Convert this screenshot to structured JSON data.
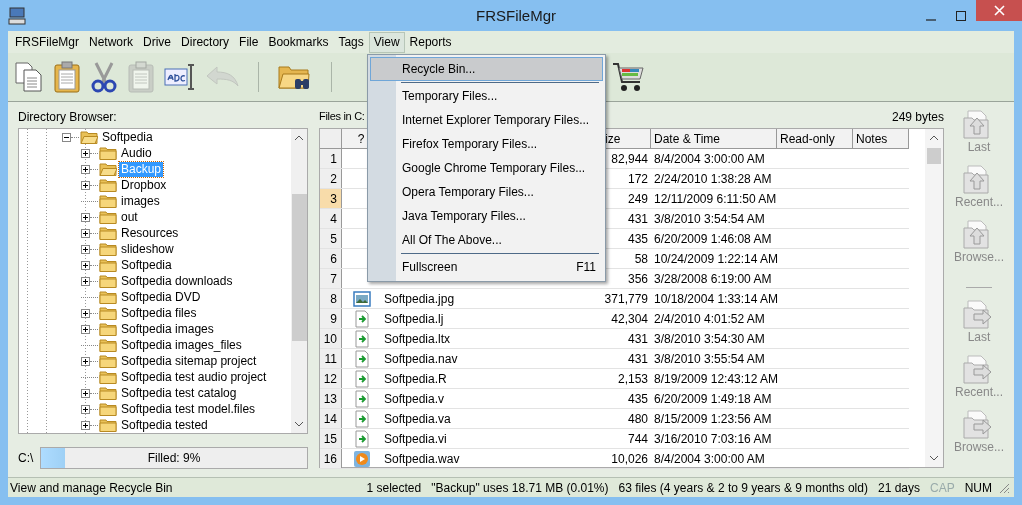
{
  "window": {
    "title": "FRSFileMgr"
  },
  "menu_bar": [
    {
      "label": "FRSFileMgr",
      "open": false
    },
    {
      "label": "Network",
      "open": false
    },
    {
      "label": "Drive",
      "open": false
    },
    {
      "label": "Directory",
      "open": false
    },
    {
      "label": "File",
      "open": false
    },
    {
      "label": "Bookmarks",
      "open": false
    },
    {
      "label": "Tags",
      "open": false
    },
    {
      "label": "View",
      "open": true
    },
    {
      "label": "Reports",
      "open": false
    }
  ],
  "toolbar": [
    {
      "kind": "copy",
      "disabled": false
    },
    {
      "kind": "paste",
      "disabled": false
    },
    {
      "kind": "cut",
      "disabled": false
    },
    {
      "kind": "paste",
      "disabled": true
    },
    {
      "kind": "rename",
      "disabled": false
    },
    {
      "kind": "undo",
      "disabled": true
    },
    {
      "kind": "separator"
    },
    {
      "kind": "find-folder",
      "disabled": false
    },
    {
      "kind": "separator"
    },
    {
      "kind": "gap"
    },
    {
      "kind": "cart",
      "disabled": false
    }
  ],
  "directory_browser": {
    "label": "Directory Browser:",
    "tree": [
      {
        "name": "Softpedia",
        "expanded": true,
        "selected": false,
        "children": [
          {
            "name": "Audio",
            "expanded": false,
            "has_children": true,
            "selected": false
          },
          {
            "name": "Backup",
            "expanded": false,
            "has_children": true,
            "selected": true
          },
          {
            "name": "Dropbox",
            "expanded": false,
            "has_children": true,
            "selected": false
          },
          {
            "name": "images",
            "expanded": false,
            "has_children": false,
            "selected": false
          },
          {
            "name": "out",
            "expanded": false,
            "has_children": true,
            "selected": false
          },
          {
            "name": "Resources",
            "expanded": false,
            "has_children": true,
            "selected": false
          },
          {
            "name": "slideshow",
            "expanded": false,
            "has_children": true,
            "selected": false
          },
          {
            "name": "Softpedia",
            "expanded": false,
            "has_children": true,
            "selected": false
          },
          {
            "name": "Softpedia downloads",
            "expanded": false,
            "has_children": true,
            "selected": false
          },
          {
            "name": "Softpedia DVD",
            "expanded": false,
            "has_children": false,
            "selected": false
          },
          {
            "name": "Softpedia files",
            "expanded": false,
            "has_children": true,
            "selected": false
          },
          {
            "name": "Softpedia images",
            "expanded": false,
            "has_children": true,
            "selected": false
          },
          {
            "name": "Softpedia images_files",
            "expanded": false,
            "has_children": false,
            "selected": false
          },
          {
            "name": "Softpedia sitemap project",
            "expanded": false,
            "has_children": true,
            "selected": false
          },
          {
            "name": "Softpedia test audio project",
            "expanded": false,
            "has_children": false,
            "selected": false
          },
          {
            "name": "Softpedia test catalog",
            "expanded": false,
            "has_children": true,
            "selected": false
          },
          {
            "name": "Softpedia test model.files",
            "expanded": false,
            "has_children": true,
            "selected": false
          },
          {
            "name": "Softpedia tested",
            "expanded": false,
            "has_children": true,
            "selected": false
          }
        ]
      }
    ],
    "drive": {
      "label": "C:\\",
      "level": 0.09,
      "reading": "Filled:  9%"
    }
  },
  "files": {
    "label": "Files in C:",
    "size_info": "249 bytes",
    "columns": [
      "?",
      "ize",
      "Date & Time",
      "Read-only",
      "Notes"
    ],
    "rows": [
      {
        "num": "1",
        "size": "82,944",
        "date": "8/4/2004 3:00:00 AM",
        "selected": false
      },
      {
        "num": "2",
        "size": "172",
        "date": "2/24/2010 1:38:28 AM",
        "selected": false
      },
      {
        "num": "3",
        "size": "249",
        "date": "12/11/2009 6:11:50 AM",
        "selected": true
      },
      {
        "num": "4",
        "size": "431",
        "date": "3/8/2010 3:54:54 AM",
        "selected": false
      },
      {
        "num": "5",
        "size": "435",
        "date": "6/20/2009 1:46:08 AM",
        "selected": false
      },
      {
        "num": "6",
        "size": "58",
        "date": "10/24/2009 1:22:14 AM",
        "selected": false
      },
      {
        "num": "7",
        "size": "356",
        "date": "3/28/2008 6:19:00 AM",
        "selected": false
      },
      {
        "num": "8",
        "kind": "image",
        "name": "Softpedia.jpg",
        "size": "371,779",
        "date": "10/18/2004 1:33:14 AM",
        "selected": false
      },
      {
        "num": "9",
        "kind": "file",
        "name": "Softpedia.lj",
        "size": "42,304",
        "date": "2/4/2010 4:01:52 AM",
        "selected": false
      },
      {
        "num": "10",
        "kind": "file",
        "name": "Softpedia.ltx",
        "size": "431",
        "date": "3/8/2010 3:54:30 AM",
        "selected": false
      },
      {
        "num": "11",
        "kind": "file",
        "name": "Softpedia.nav",
        "size": "431",
        "date": "3/8/2010 3:55:54 AM",
        "selected": false
      },
      {
        "num": "12",
        "kind": "file",
        "name": "Softpedia.R",
        "size": "2,153",
        "date": "8/19/2009 12:43:12 AM",
        "selected": false
      },
      {
        "num": "13",
        "kind": "file",
        "name": "Softpedia.v",
        "size": "435",
        "date": "6/20/2009 1:49:18 AM",
        "selected": false
      },
      {
        "num": "14",
        "kind": "file",
        "name": "Softpedia.va",
        "size": "480",
        "date": "8/15/2009 1:23:56 AM",
        "selected": false
      },
      {
        "num": "15",
        "kind": "file",
        "name": "Softpedia.vi",
        "size": "744",
        "date": "3/16/2010 7:03:16 AM",
        "selected": false
      },
      {
        "num": "16",
        "kind": "audio",
        "name": "Softpedia.wav",
        "size": "10,026",
        "date": "8/4/2004 3:00:00 AM",
        "selected": false
      }
    ]
  },
  "side_buttons": [
    {
      "kind": "open",
      "label": "Last"
    },
    {
      "kind": "open",
      "label": "Recent..."
    },
    {
      "kind": "open",
      "label": "Browse..."
    },
    {
      "kind": "separator"
    },
    {
      "kind": "save",
      "label": "Last"
    },
    {
      "kind": "save",
      "label": "Recent..."
    },
    {
      "kind": "save",
      "label": "Browse..."
    }
  ],
  "view_menu": [
    {
      "kind": "item",
      "label": "Recycle Bin...",
      "selected": true
    },
    {
      "kind": "separator"
    },
    {
      "kind": "item",
      "label": "Temporary Files...",
      "selected": false
    },
    {
      "kind": "item",
      "label": "Internet Explorer Temporary Files...",
      "selected": false
    },
    {
      "kind": "item",
      "label": "Firefox Temporary Files...",
      "selected": false
    },
    {
      "kind": "item",
      "label": "Google Chrome Temporary Files...",
      "selected": false
    },
    {
      "kind": "item",
      "label": "Opera Temporary Files...",
      "selected": false
    },
    {
      "kind": "item",
      "label": "Java Temporary Files...",
      "selected": false
    },
    {
      "kind": "item",
      "label": "All Of The Above...",
      "selected": false
    },
    {
      "kind": "separator"
    },
    {
      "kind": "item",
      "label": "Fullscreen",
      "shortcut": "F11",
      "selected": false
    }
  ],
  "status_bar": {
    "message": "View and manage Recycle Bin",
    "panes": [
      {
        "text": "1 selected",
        "active": true
      },
      {
        "text": "\"Backup\"  uses 18.71 MB (0.01%)",
        "active": true
      },
      {
        "text": "63 files (4 years & 2 to 9 years & 9 months old)",
        "active": true
      },
      {
        "text": "21 days",
        "active": true
      },
      {
        "text": "CAP",
        "active": false
      },
      {
        "text": "NUM",
        "active": true
      }
    ]
  }
}
